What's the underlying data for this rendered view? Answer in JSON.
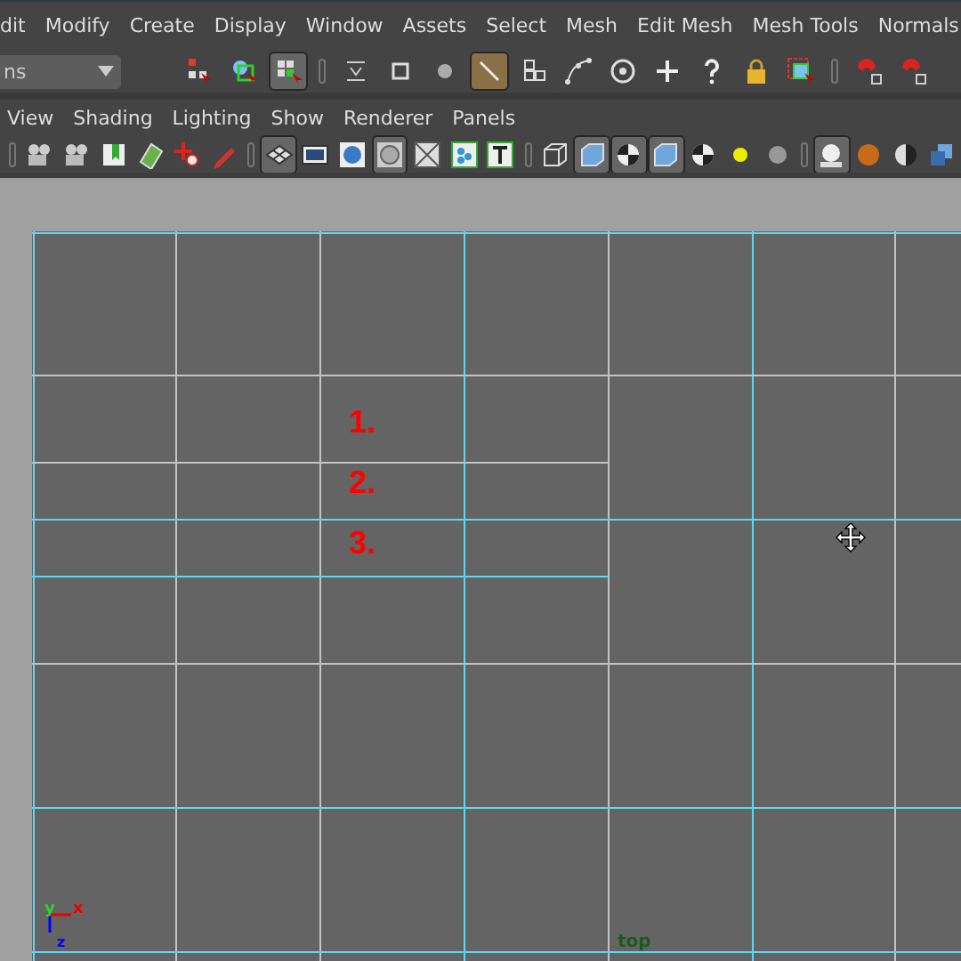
{
  "main_menu": [
    "dit",
    "Modify",
    "Create",
    "Display",
    "Window",
    "Assets",
    "Select",
    "Mesh",
    "Edit Mesh",
    "Mesh Tools",
    "Normals"
  ],
  "status_line": {
    "menu_set": "ns",
    "tools": [
      {
        "kind": "hierarchy",
        "selected": false
      },
      {
        "kind": "object",
        "selected": false
      },
      {
        "kind": "component",
        "selected": true
      },
      {
        "kind": "sep"
      },
      {
        "kind": "lines",
        "selected": false
      },
      {
        "kind": "square",
        "selected": false
      },
      {
        "kind": "dot",
        "selected": false
      },
      {
        "kind": "diagonal",
        "selected": true
      },
      {
        "kind": "tiles",
        "selected": false
      },
      {
        "kind": "curve",
        "selected": false
      },
      {
        "kind": "target",
        "selected": false
      },
      {
        "kind": "plus",
        "selected": false
      },
      {
        "kind": "question",
        "selected": false
      },
      {
        "kind": "lock",
        "selected": false
      },
      {
        "kind": "marquee",
        "selected": false
      },
      {
        "kind": "sep"
      },
      {
        "kind": "magnet",
        "selected": false
      },
      {
        "kind": "magnet",
        "selected": false
      }
    ]
  },
  "panel_menu": [
    "View",
    "Shading",
    "Lighting",
    "Show",
    "Renderer",
    "Panels"
  ],
  "panel_toolbar": [
    {
      "kind": "camera",
      "selected": false
    },
    {
      "kind": "camera",
      "selected": false
    },
    {
      "kind": "bookmark",
      "selected": false
    },
    {
      "kind": "picture",
      "selected": false
    },
    {
      "kind": "crosshair",
      "selected": false
    },
    {
      "kind": "pencil",
      "selected": false
    },
    {
      "kind": "sep"
    },
    {
      "kind": "gridplane",
      "selected": true
    },
    {
      "kind": "film",
      "selected": false
    },
    {
      "kind": "sphere",
      "selected": false
    },
    {
      "kind": "ring",
      "selected": true
    },
    {
      "kind": "crossbox",
      "selected": false
    },
    {
      "kind": "dots",
      "selected": false
    },
    {
      "kind": "letter",
      "selected": false
    },
    {
      "kind": "sep"
    },
    {
      "kind": "wirecube",
      "selected": false
    },
    {
      "kind": "cube",
      "selected": true
    },
    {
      "kind": "checker",
      "selected": true
    },
    {
      "kind": "cube",
      "selected": true
    },
    {
      "kind": "checker",
      "selected": false
    },
    {
      "kind": "light",
      "selected": false
    },
    {
      "kind": "greysphere",
      "selected": false
    },
    {
      "kind": "sep"
    },
    {
      "kind": "whitesphere",
      "selected": true
    },
    {
      "kind": "orangesphere",
      "selected": false
    },
    {
      "kind": "halfsphere",
      "selected": false
    },
    {
      "kind": "cubes",
      "selected": false
    }
  ],
  "viewport": {
    "annotations": [
      "1.",
      "2.",
      "3."
    ],
    "camera_label": "top",
    "axes": [
      "y",
      "x",
      "z"
    ]
  }
}
